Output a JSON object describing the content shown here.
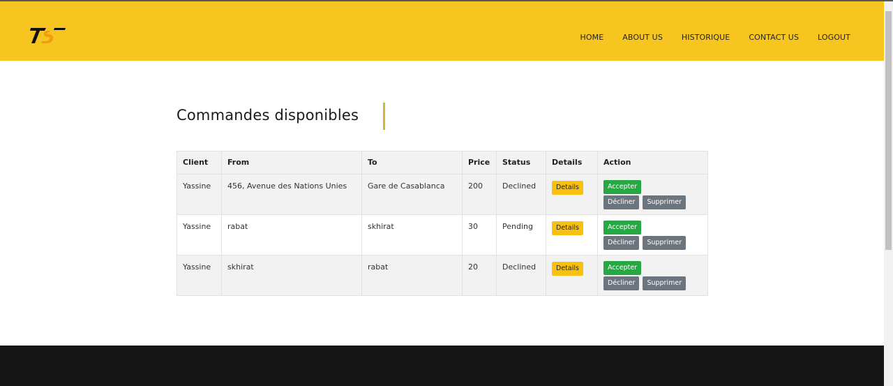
{
  "nav": {
    "home": "HOME",
    "about": "ABOUT US",
    "historique": "HISTORIQUE",
    "contact": "CONTACT US",
    "logout": "LOGOUT"
  },
  "colors": {
    "header_bg": "#f7c520",
    "accent": "#f9c10f",
    "accept": "#28a745",
    "secondary": "#6c757d",
    "footer_bg": "#161616"
  },
  "logo": {
    "text": "TS"
  },
  "main": {
    "title": "Commandes disponibles"
  },
  "table": {
    "headers": [
      "Client",
      "From",
      "To",
      "Price",
      "Status",
      "Details",
      "Action"
    ],
    "rows": [
      {
        "client": "Yassine",
        "from": "456, Avenue des Nations Unies",
        "to": "Gare de Casablanca",
        "price": "200",
        "status": "Declined"
      },
      {
        "client": "Yassine",
        "from": "rabat",
        "to": "skhirat",
        "price": "30",
        "status": "Pending"
      },
      {
        "client": "Yassine",
        "from": "skhirat",
        "to": "rabat",
        "price": "20",
        "status": "Declined"
      }
    ],
    "details_label": "Details",
    "accept_label": "Accepter",
    "decline_label": "Décliner",
    "delete_label": "Supprimer"
  }
}
